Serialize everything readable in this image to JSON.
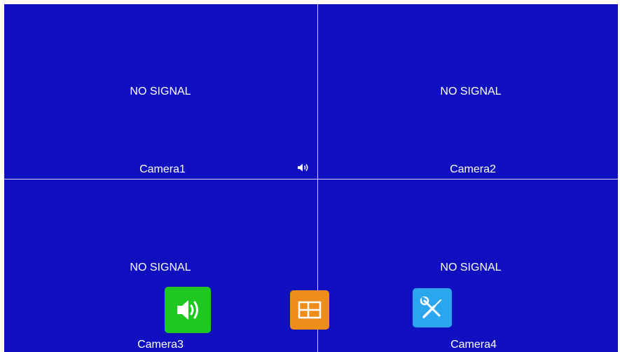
{
  "quadrants": [
    {
      "status": "NO SIGNAL",
      "camera": "Camera1"
    },
    {
      "status": "NO SIGNAL",
      "camera": "Camera2"
    },
    {
      "status": "NO SIGNAL",
      "camera": "Camera3"
    },
    {
      "status": "NO SIGNAL",
      "camera": "Camera4"
    }
  ],
  "icons": {
    "audio_indicator": "speaker-icon",
    "audio_button": "speaker-icon",
    "layout_button": "split-layout-icon",
    "settings_button": "tools-icon"
  },
  "colors": {
    "background": "#1010c0",
    "divider": "#d8d8f0",
    "text": "#ffffff",
    "audio_button": "#1ec81e",
    "layout_button": "#ef8d1a",
    "settings_button": "#2aa6ef"
  }
}
